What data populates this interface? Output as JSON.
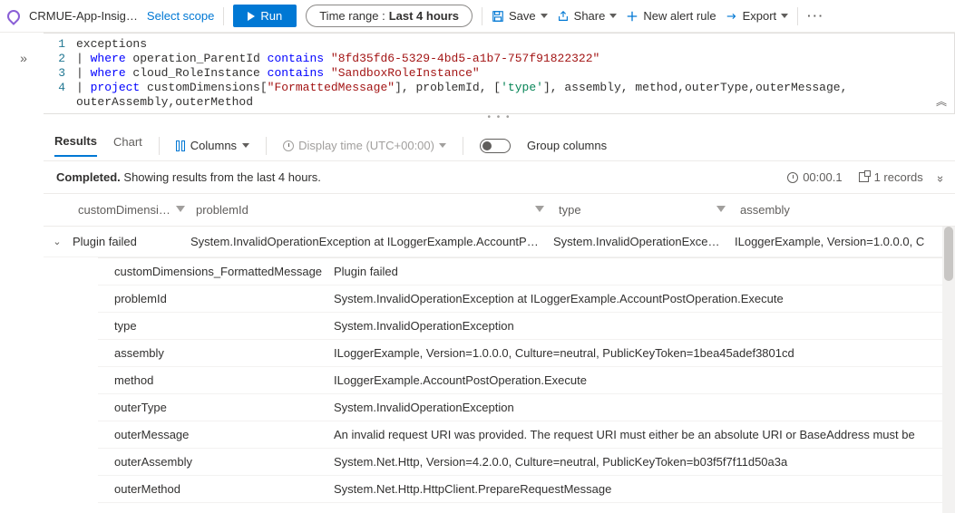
{
  "toolbar": {
    "scope_name": "CRMUE-App-Insig…",
    "select_scope": "Select scope",
    "run": "Run",
    "time_range_label": "Time range :",
    "time_range_value": "Last 4 hours",
    "save": "Save",
    "share": "Share",
    "new_alert": "New alert rule",
    "export": "Export"
  },
  "editor": {
    "lines": [
      {
        "n": "1",
        "seg": [
          {
            "t": "exceptions",
            "c": ""
          }
        ]
      },
      {
        "n": "2",
        "seg": [
          {
            "t": "| ",
            "c": ""
          },
          {
            "t": "where",
            "c": "kw"
          },
          {
            "t": " operation_ParentId ",
            "c": ""
          },
          {
            "t": "contains",
            "c": "kw"
          },
          {
            "t": " ",
            "c": ""
          },
          {
            "t": "\"8fd35fd6-5329-4bd5-a1b7-757f91822322\"",
            "c": "str"
          }
        ]
      },
      {
        "n": "3",
        "seg": [
          {
            "t": "| ",
            "c": ""
          },
          {
            "t": "where",
            "c": "kw"
          },
          {
            "t": " cloud_RoleInstance ",
            "c": ""
          },
          {
            "t": "contains",
            "c": "kw"
          },
          {
            "t": " ",
            "c": ""
          },
          {
            "t": "\"SandboxRoleInstance\"",
            "c": "str"
          }
        ]
      },
      {
        "n": "4",
        "seg": [
          {
            "t": "| ",
            "c": ""
          },
          {
            "t": "project",
            "c": "kw"
          },
          {
            "t": " customDimensions[",
            "c": ""
          },
          {
            "t": "\"FormattedMessage\"",
            "c": "str"
          },
          {
            "t": "], problemId, [",
            "c": ""
          },
          {
            "t": "'type'",
            "c": "br"
          },
          {
            "t": "], assembly, method,outerType,outerMessage,",
            "c": ""
          }
        ]
      },
      {
        "n": "",
        "seg": [
          {
            "t": "outerAssembly,outerMethod",
            "c": ""
          }
        ]
      }
    ]
  },
  "tabs": {
    "results": "Results",
    "chart": "Chart",
    "columns": "Columns",
    "display_time": "Display time (UTC+00:00)",
    "group_columns": "Group columns"
  },
  "status": {
    "completed": "Completed.",
    "showing": " Showing results from the last 4 hours.",
    "elapsed": "00:00.1",
    "records": "1 records"
  },
  "grid": {
    "headers": {
      "c1": "customDimensi…",
      "c2": "problemId",
      "c3": "type",
      "c4": "assembly"
    },
    "row": {
      "c1": "Plugin failed",
      "c2": "System.InvalidOperationException at ILoggerExample.AccountP…",
      "c3": "System.InvalidOperationExce…",
      "c4": "ILoggerExample, Version=1.0.0.0, C"
    },
    "details": [
      {
        "k": "customDimensions_FormattedMessage",
        "v": "Plugin failed"
      },
      {
        "k": "problemId",
        "v": "System.InvalidOperationException at ILoggerExample.AccountPostOperation.Execute"
      },
      {
        "k": "type",
        "v": "System.InvalidOperationException"
      },
      {
        "k": "assembly",
        "v": "ILoggerExample, Version=1.0.0.0, Culture=neutral, PublicKeyToken=1bea45adef3801cd"
      },
      {
        "k": "method",
        "v": "ILoggerExample.AccountPostOperation.Execute"
      },
      {
        "k": "outerType",
        "v": "System.InvalidOperationException"
      },
      {
        "k": "outerMessage",
        "v": "An invalid request URI was provided. The request URI must either be an absolute URI or BaseAddress must be"
      },
      {
        "k": "outerAssembly",
        "v": "System.Net.Http, Version=4.2.0.0, Culture=neutral, PublicKeyToken=b03f5f7f11d50a3a"
      },
      {
        "k": "outerMethod",
        "v": "System.Net.Http.HttpClient.PrepareRequestMessage"
      }
    ]
  }
}
